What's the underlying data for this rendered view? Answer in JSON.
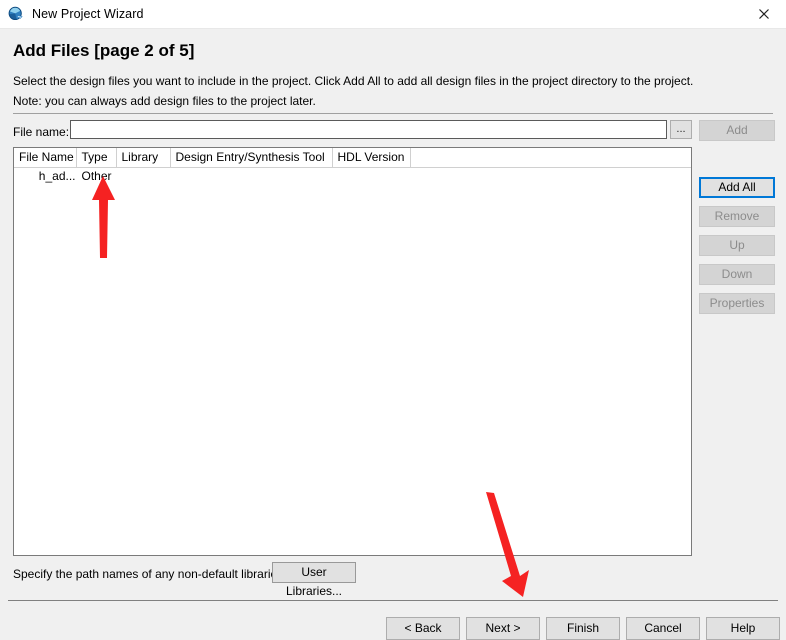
{
  "window": {
    "title": "New Project Wizard",
    "icon": "quartus-globe-icon",
    "close_label": "✕"
  },
  "page": {
    "title": "Add Files [page 2 of 5]",
    "description_line1": "Select the design files you want to include in the project. Click Add All to add all design files in the project directory to the project.",
    "description_line2": "Note: you can always add design files to the project later."
  },
  "file_name_row": {
    "label": "File name:",
    "value": "",
    "placeholder": "",
    "browse_label": "..."
  },
  "side_buttons": [
    {
      "label": "Add",
      "enabled": false,
      "name": "add-button"
    },
    {
      "label": "Add All",
      "enabled": true,
      "name": "add-all-button"
    },
    {
      "label": "Remove",
      "enabled": false,
      "name": "remove-button"
    },
    {
      "label": "Up",
      "enabled": false,
      "name": "up-button"
    },
    {
      "label": "Down",
      "enabled": false,
      "name": "down-button"
    },
    {
      "label": "Properties",
      "enabled": false,
      "name": "properties-button"
    }
  ],
  "file_table": {
    "columns": [
      "File Name",
      "Type",
      "Library",
      "Design Entry/Synthesis Tool",
      "HDL Version",
      ""
    ],
    "rows": [
      {
        "file_name": "h_ad...",
        "type": "Other",
        "library": "",
        "tool": "",
        "hdl_version": "",
        "extra": ""
      }
    ]
  },
  "libraries": {
    "text": "Specify the path names of any non-default libraries.",
    "button_label": "User Libraries..."
  },
  "nav_buttons": [
    {
      "label": "< Back",
      "name": "back-button"
    },
    {
      "label": "Next >",
      "name": "next-button"
    },
    {
      "label": "Finish",
      "name": "finish-button"
    },
    {
      "label": "Cancel",
      "name": "cancel-button"
    },
    {
      "label": "Help",
      "name": "help-button"
    }
  ],
  "annotations": [
    {
      "name": "arrow-pointing-to-type-other",
      "color": "#f52222",
      "target": "Other"
    },
    {
      "name": "arrow-pointing-to-next-button",
      "color": "#f52222",
      "target": "Next >"
    }
  ],
  "colors": {
    "window_background": "#f0f0f0",
    "titlebar_background": "#ffffff",
    "field_background": "#ffffff",
    "focus_border": "#0078d7",
    "annotation_red": "#f52222",
    "disabled_text": "#8c8c8c"
  }
}
